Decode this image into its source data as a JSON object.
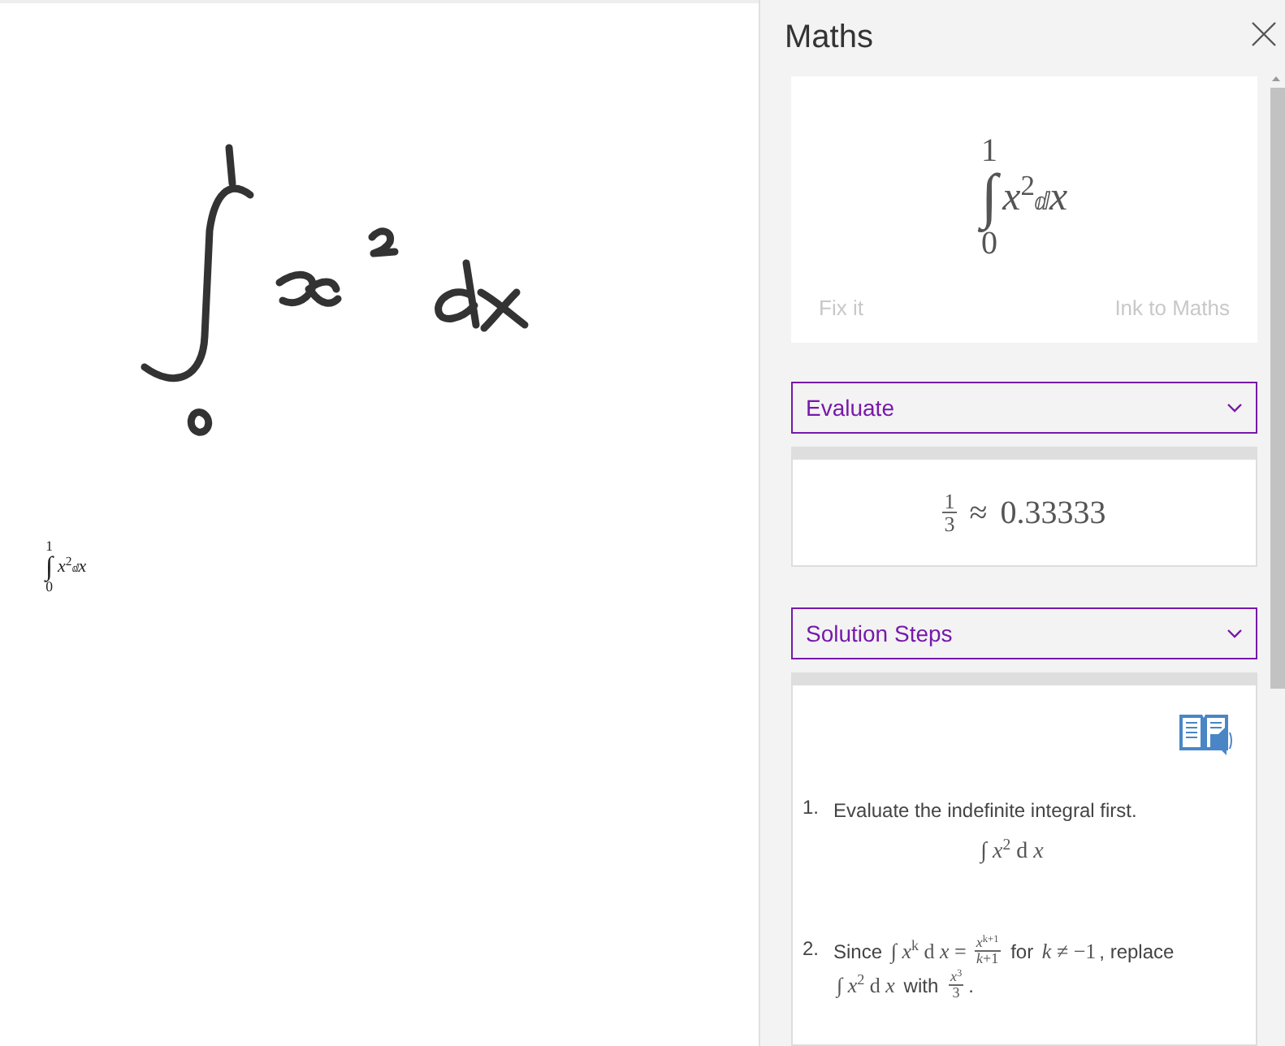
{
  "canvas": {
    "converted_equation": {
      "upper": "1",
      "sign": "∫",
      "lower": "0",
      "variable": "x",
      "exponent": "2",
      "differential": "ⅆ",
      "differential_variable": "x"
    }
  },
  "maths_pane": {
    "title": "Maths",
    "input": {
      "equation": {
        "upper": "1",
        "sign": "∫",
        "lower": "0",
        "variable": "x",
        "exponent": "2",
        "differential": "ⅆ",
        "differential_variable": "x"
      },
      "actions": [
        {
          "label": "Fix it",
          "disabled": true
        },
        {
          "label": "Ink to Maths",
          "disabled": true
        }
      ]
    },
    "sections": [
      {
        "dropdown": "Evaluate",
        "result": {
          "numerator": "1",
          "denominator": "3",
          "relation": "≈",
          "value": "0.33333"
        }
      },
      {
        "dropdown": "Solution Steps",
        "steps": [
          {
            "number": "1.",
            "lines": [
              [
                {
                  "kind": "text",
                  "text": "Evaluate the indefinite integral first."
                }
              ]
            ],
            "formula": "∫ *x*$^{2}$ d *x*"
          },
          {
            "number": "2.",
            "lines": [
              [
                {
                  "kind": "text",
                  "text": "Since "
                },
                {
                  "kind": "math",
                  "text": "∫ *x*$^{k}$ d *x* ="
                },
                {
                  "kind": "frac",
                  "numerator": "*x*$^{k+1}$",
                  "denominator": "*k*+1"
                },
                {
                  "kind": "text",
                  "text": " for "
                },
                {
                  "kind": "math",
                  "text": "*k* ≠ −1"
                },
                {
                  "kind": "text",
                  "text": ", replace"
                }
              ],
              [
                {
                  "kind": "math",
                  "text": "∫ *x*$^{2}$ d *x*"
                },
                {
                  "kind": "text",
                  "text": " with "
                },
                {
                  "kind": "frac",
                  "numerator": "*x*$^{3}$",
                  "denominator": "3"
                },
                {
                  "kind": "text",
                  "text": "."
                }
              ]
            ]
          }
        ]
      }
    ]
  }
}
